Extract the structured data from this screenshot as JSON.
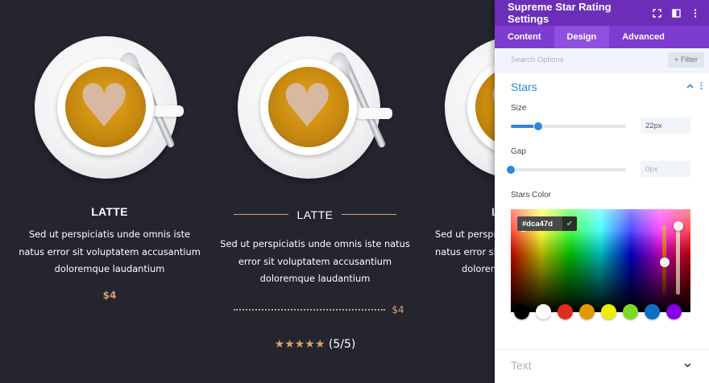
{
  "cards": [
    {
      "title": "LATTE",
      "description_lines": [
        "Sed ut perspiciatis unde omnis iste",
        "natus error sit voluptatem accusantium",
        "doloremque laudantium"
      ],
      "price": "$4"
    },
    {
      "title": "LATTE",
      "description_lines": [
        "Sed ut perspiciatis unde omnis iste natus",
        "error sit voluptatem accusantium",
        "doloremque laudantium"
      ],
      "price": "$4",
      "rating_stars": "★★★★★",
      "rating_text": "(5/5)",
      "rating_value": 5,
      "rating_max": 5
    },
    {
      "title": "L",
      "description_lines": [
        "Sed ut perspiciatis",
        "natus error sit vo",
        "dolorem"
      ]
    }
  ],
  "panel": {
    "title": "Supreme Star Rating Settings",
    "tabs": [
      "Content",
      "Design",
      "Advanced"
    ],
    "active_tab": "Design",
    "search_placeholder": "Search Options",
    "filter_label": "+ Filter",
    "section_title": "Stars",
    "size_label": "Size",
    "size_value": "22px",
    "size_fraction": 0.24,
    "gap_label": "Gap",
    "gap_value": "0px",
    "gap_fraction": 0,
    "color_label": "Stars Color",
    "color_hex": "#dca47d",
    "swatches": [
      "#000000",
      "#ffffff",
      "#e02b20",
      "#e09900",
      "#edf000",
      "#7cda24",
      "#0c71c3",
      "#8300e9"
    ],
    "text_section": "Text"
  },
  "colors": {
    "accent": "#d8a16f",
    "panel_header": "#6c2eb9",
    "tab_bar": "#7e3bd0",
    "link_blue": "#2b87da",
    "background": "#252530"
  }
}
